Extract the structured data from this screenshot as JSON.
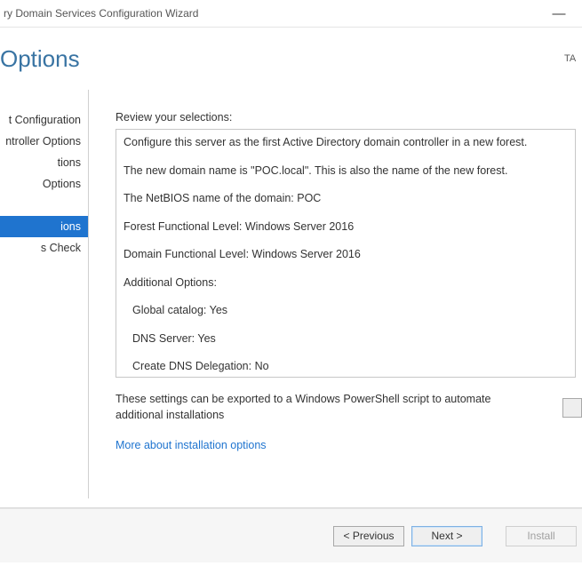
{
  "window": {
    "title": "ry Domain Services Configuration Wizard",
    "minimize": "—"
  },
  "header": {
    "title": "Options",
    "target_label": "TA"
  },
  "sidebar": {
    "items": [
      {
        "label": "t Configuration",
        "selected": false
      },
      {
        "label": "ntroller Options",
        "selected": false
      },
      {
        "label": "tions",
        "selected": false
      },
      {
        "label": "Options",
        "selected": false
      },
      {
        "label": "",
        "selected": false
      },
      {
        "label": "ions",
        "selected": true
      },
      {
        "label": "s Check",
        "selected": false
      }
    ]
  },
  "main": {
    "review_label": "Review your selections:",
    "review_lines": [
      "Configure this server as the first Active Directory domain controller in a new forest.",
      "The new domain name is \"POC.local\". This is also the name of the new forest.",
      "The NetBIOS name of the domain: POC",
      "Forest Functional Level: Windows Server 2016",
      "Domain Functional Level: Windows Server 2016",
      "Additional Options:"
    ],
    "review_sub": [
      "Global catalog: Yes",
      "DNS Server: Yes",
      "Create DNS Delegation: No"
    ],
    "export_text": "These settings can be exported to a Windows PowerShell script to automate additional installations",
    "link_text": "More about installation options"
  },
  "footer": {
    "previous": "< Previous",
    "next": "Next >",
    "install": "Install"
  }
}
